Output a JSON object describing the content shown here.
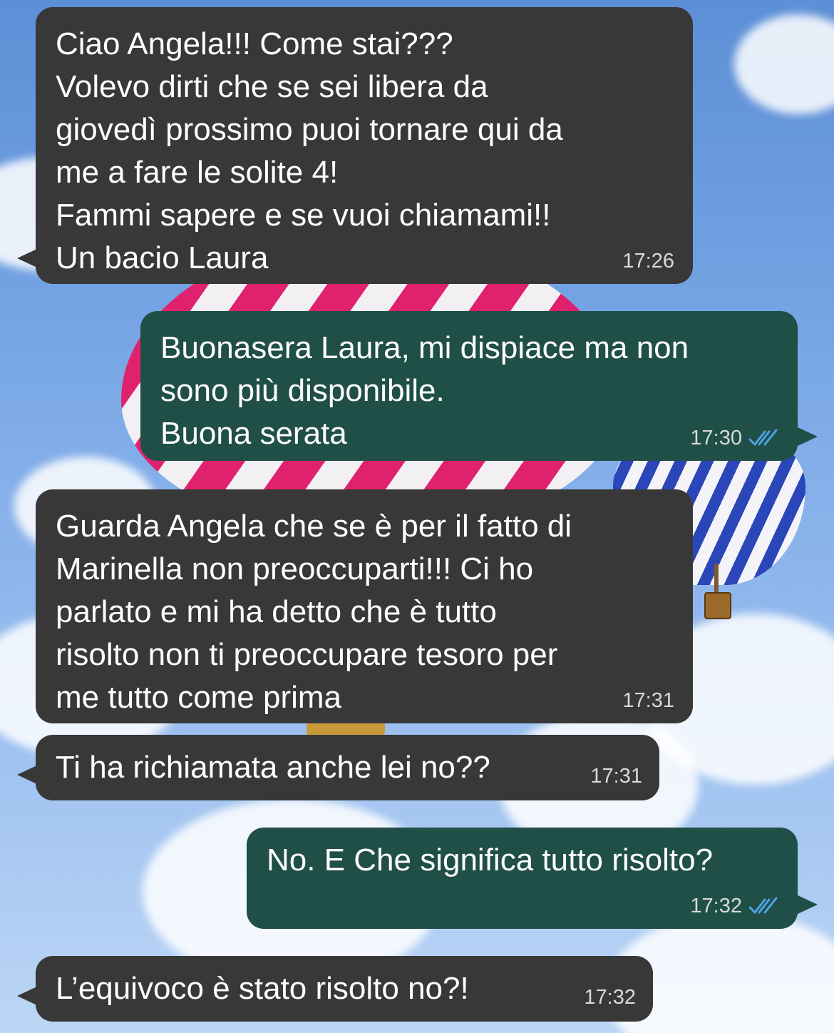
{
  "chat": {
    "messages": [
      {
        "direction": "incoming",
        "text": "Ciao Angela!!! Come stai???\nVolevo dirti che se sei libera da\ngiovedì prossimo puoi tornare qui da\nme a fare le solite 4!\nFammi sapere e se vuoi chiamami!!\nUn bacio Laura",
        "time": "17:26"
      },
      {
        "direction": "outgoing",
        "text": "Buonasera Laura, mi dispiace ma non\nsono più disponibile.\nBuona serata",
        "time": "17:30",
        "status": "read"
      },
      {
        "direction": "incoming",
        "text": "Guarda Angela che se è per il fatto di\nMarinella non preoccuparti!!! Ci ho\nparlato e mi ha detto che è tutto\nrisolto non ti preoccupare tesoro per\nme tutto come prima",
        "time": "17:31"
      },
      {
        "direction": "incoming",
        "text": "Ti ha richiamata anche lei no??",
        "time": "17:31"
      },
      {
        "direction": "outgoing",
        "text": "No. E Che significa tutto risolto?",
        "time": "17:32",
        "status": "read"
      },
      {
        "direction": "incoming",
        "text": "L’equivoco è stato risolto no?!",
        "time": "17:32"
      }
    ]
  },
  "colors": {
    "incoming_bubble": "#383838",
    "outgoing_bubble": "#1f4f46",
    "read_ticks": "#4fa3e6"
  },
  "icons": {
    "read_status": "double-check-icon"
  }
}
